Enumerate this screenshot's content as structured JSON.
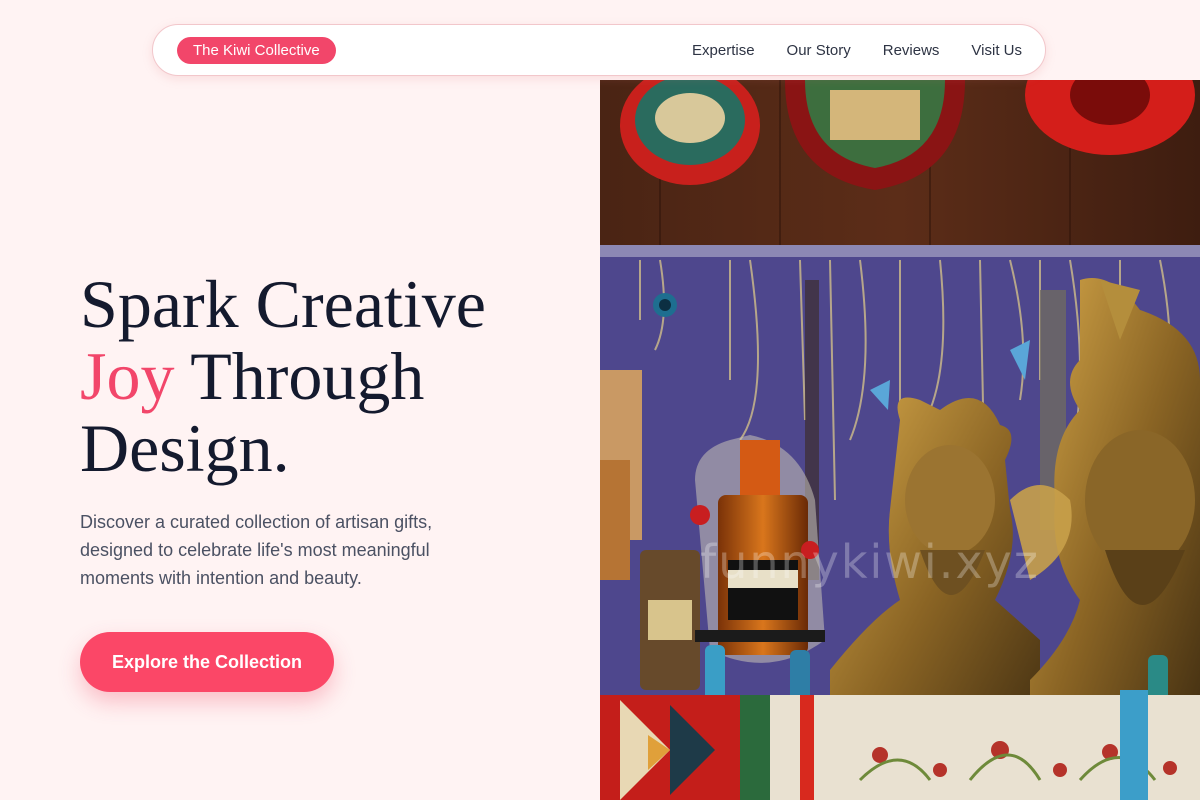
{
  "nav": {
    "brand": "The Kiwi Collective",
    "links": [
      "Expertise",
      "Our Story",
      "Reviews",
      "Visit Us"
    ]
  },
  "hero": {
    "heading_line1": "Spark Creative",
    "heading_accent": "Joy",
    "heading_line2_rest": " Through",
    "heading_line3": "Design.",
    "subtitle": "Discover a curated collection of artisan gifts, designed to celebrate life's most meaningful moments with intention and beauty.",
    "cta_label": "Explore the Collection",
    "image_watermark": "funnykiwi.xyz"
  },
  "colors": {
    "accent": "#f2466a",
    "background": "#fff3f3",
    "heading": "#141a2e",
    "body_text": "#4b5163"
  }
}
